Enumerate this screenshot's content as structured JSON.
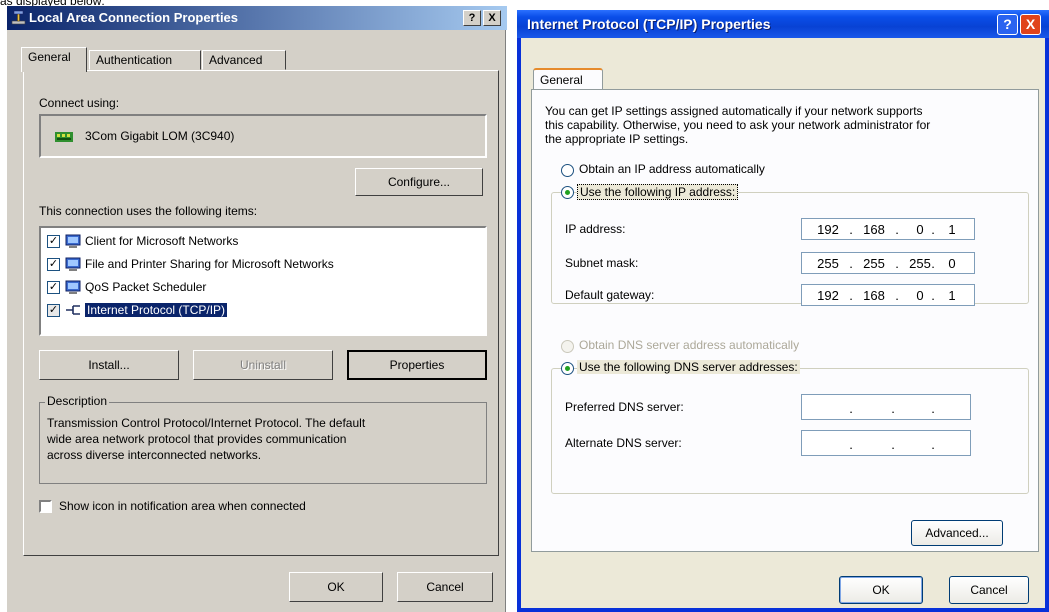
{
  "page_caption": "as displayed below:",
  "left": {
    "title": "Local Area Connection Properties",
    "help_btn": "?",
    "close_btn": "X",
    "tabs": [
      "General",
      "Authentication",
      "Advanced"
    ],
    "connect_using_label": "Connect using:",
    "adapter_name": "3Com Gigabit LOM (3C940)",
    "configure_btn": "Configure...",
    "items_label": "This connection uses the following items:",
    "items": [
      {
        "label": "Client for Microsoft Networks",
        "checked": true
      },
      {
        "label": "File and Printer Sharing for Microsoft Networks",
        "checked": true
      },
      {
        "label": "QoS Packet Scheduler",
        "checked": true
      },
      {
        "label": "Internet Protocol (TCP/IP)",
        "checked": true,
        "selected": true
      }
    ],
    "install_btn": "Install...",
    "uninstall_btn": "Uninstall",
    "properties_btn": "Properties",
    "description_label": "Description",
    "description_lines": [
      "Transmission Control Protocol/Internet Protocol. The default",
      "wide area network protocol that provides communication",
      "across diverse interconnected networks."
    ],
    "show_icon_label": "Show icon in notification area when connected",
    "ok_btn": "OK",
    "cancel_btn": "Cancel"
  },
  "right": {
    "title": "Internet Protocol (TCP/IP) Properties",
    "help_btn": "?",
    "close_btn": "X",
    "tab": "General",
    "intro_lines": [
      "You can get IP settings assigned automatically if your network supports",
      "this capability. Otherwise, you need to ask your network administrator for",
      "the appropriate IP settings."
    ],
    "obtain_ip_label": "Obtain an IP address automatically",
    "use_ip_label": "Use the following IP address:",
    "ip_address_label": "IP address:",
    "ip_address": [
      "192",
      "168",
      "0",
      "1"
    ],
    "subnet_label": "Subnet mask:",
    "subnet": [
      "255",
      "255",
      "255",
      "0"
    ],
    "gateway_label": "Default gateway:",
    "gateway": [
      "192",
      "168",
      "0",
      "1"
    ],
    "obtain_dns_label": "Obtain DNS server address automatically",
    "use_dns_label": "Use the following DNS server addresses:",
    "preferred_dns_label": "Preferred DNS server:",
    "alternate_dns_label": "Alternate DNS server:",
    "advanced_btn": "Advanced...",
    "ok_btn": "OK",
    "cancel_btn": "Cancel"
  },
  "colors": {
    "classic_title": "#0a246a",
    "xp_title": "#0a4ee8",
    "xp_close": "#e0431b",
    "selection": "#0a246a"
  }
}
